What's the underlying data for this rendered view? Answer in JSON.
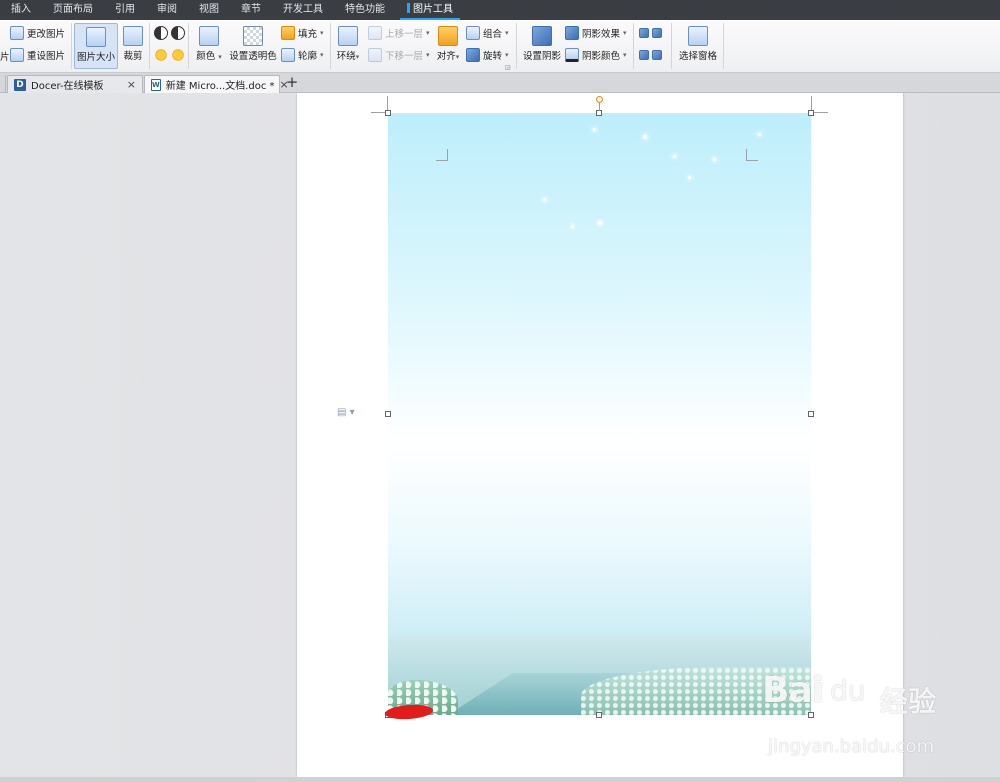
{
  "menu": {
    "tabs": [
      "插入",
      "页面布局",
      "引用",
      "审阅",
      "视图",
      "章节",
      "开发工具",
      "特色功能",
      "图片工具"
    ],
    "active_tab": "图片工具"
  },
  "ribbon": {
    "change_picture": "更改图片",
    "reset_picture": "重设图片",
    "left_cut_label": "片",
    "picture_size": "图片大小",
    "crop": "裁剪",
    "color": "颜色",
    "set_transparent": "设置透明色",
    "fill": "填充",
    "outline": "轮廓",
    "wrap": "环绕",
    "bring_forward": "上移一层",
    "send_backward": "下移一层",
    "align": "对齐",
    "group": "组合",
    "rotate": "旋转",
    "set_shadow": "设置阴影",
    "shadow_effect": "阴影效果",
    "shadow_color": "阴影颜色",
    "selection_pane": "选择窗格"
  },
  "doc_tabs": [
    {
      "title": "Docer-在线模板",
      "logo": "D",
      "close": "×"
    },
    {
      "title": "新建 Micro...文档.doc *",
      "logo": "W",
      "close": "×"
    }
  ],
  "new_tab_symbol": "+",
  "watermark": {
    "logo": "Bai",
    "logo_tail": "du",
    "cn": "经验",
    "url": "jingyan.baidu.com"
  },
  "colors": {
    "accent": "#2aa3ff",
    "menubar_bg": "#3a3d42",
    "selection_handle_rotate": "#e58a2a",
    "red_mark": "#e21b1b"
  }
}
